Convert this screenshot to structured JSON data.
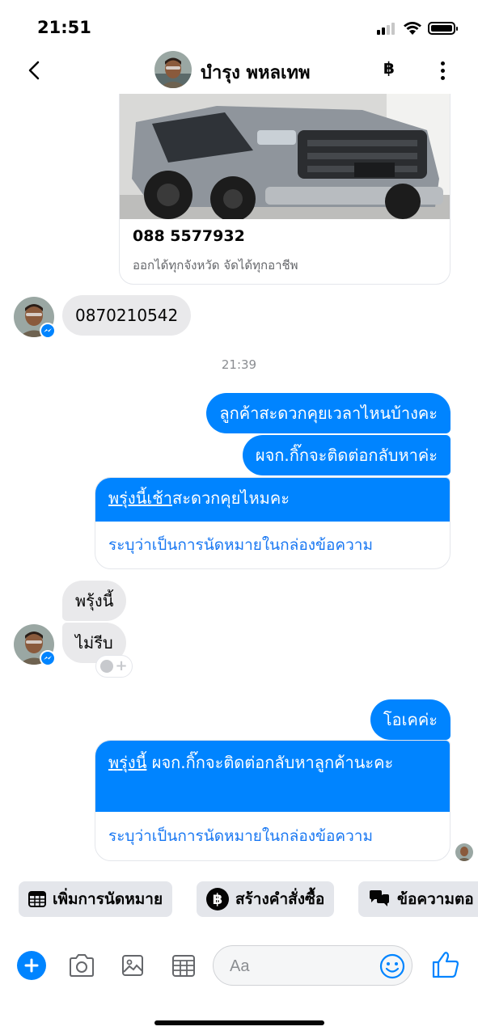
{
  "status_bar": {
    "time": "21:51"
  },
  "header": {
    "contact_name": "บำรุง พหลเทพ",
    "baht_symbol": "฿"
  },
  "car_card": {
    "phone": "088 5577932",
    "subtitle": "ออกได้ทุกจังหวัด จัดได้ทุกอาชีพ"
  },
  "messages": {
    "incoming_phone": "0870210542",
    "timestamp": "21:39",
    "out_1": "ลูกค้าสะดวกคุยเวลาไหนบ้างคะ",
    "out_2": "ผจก.กิ๊กจะติดต่อกลับหาค่ะ",
    "appt_1_date": "พรุ่งนี้เช้า",
    "appt_1_rest": "สะดวกคุยไหมคะ",
    "appt_1_link": "ระบุว่าเป็นการนัดหมายในกล่องข้อความ",
    "in_1": "พรุ้งนี้",
    "in_2": "ไม่รีบ",
    "out_3": "โอเคค่ะ",
    "appt_2_date": "พรุ่งนี้",
    "appt_2_rest": " ผจก.กิ๊กจะติดต่อกลับหาลูกค้านะคะ",
    "appt_2_link": "ระบุว่าเป็นการนัดหมายในกล่องข้อความ"
  },
  "quick_actions": [
    {
      "label": "เพิ่มการนัดหมาย",
      "icon": "calendar-icon"
    },
    {
      "label": "สร้างคำสั่งซื้อ",
      "icon": "baht-icon"
    },
    {
      "label": "ข้อความตอ",
      "icon": "chat-bubbles-icon"
    }
  ],
  "composer": {
    "placeholder": "Aa"
  },
  "colors": {
    "accent": "#0084ff",
    "incoming_bubble": "#e9e9eb",
    "link": "#1877f2"
  }
}
